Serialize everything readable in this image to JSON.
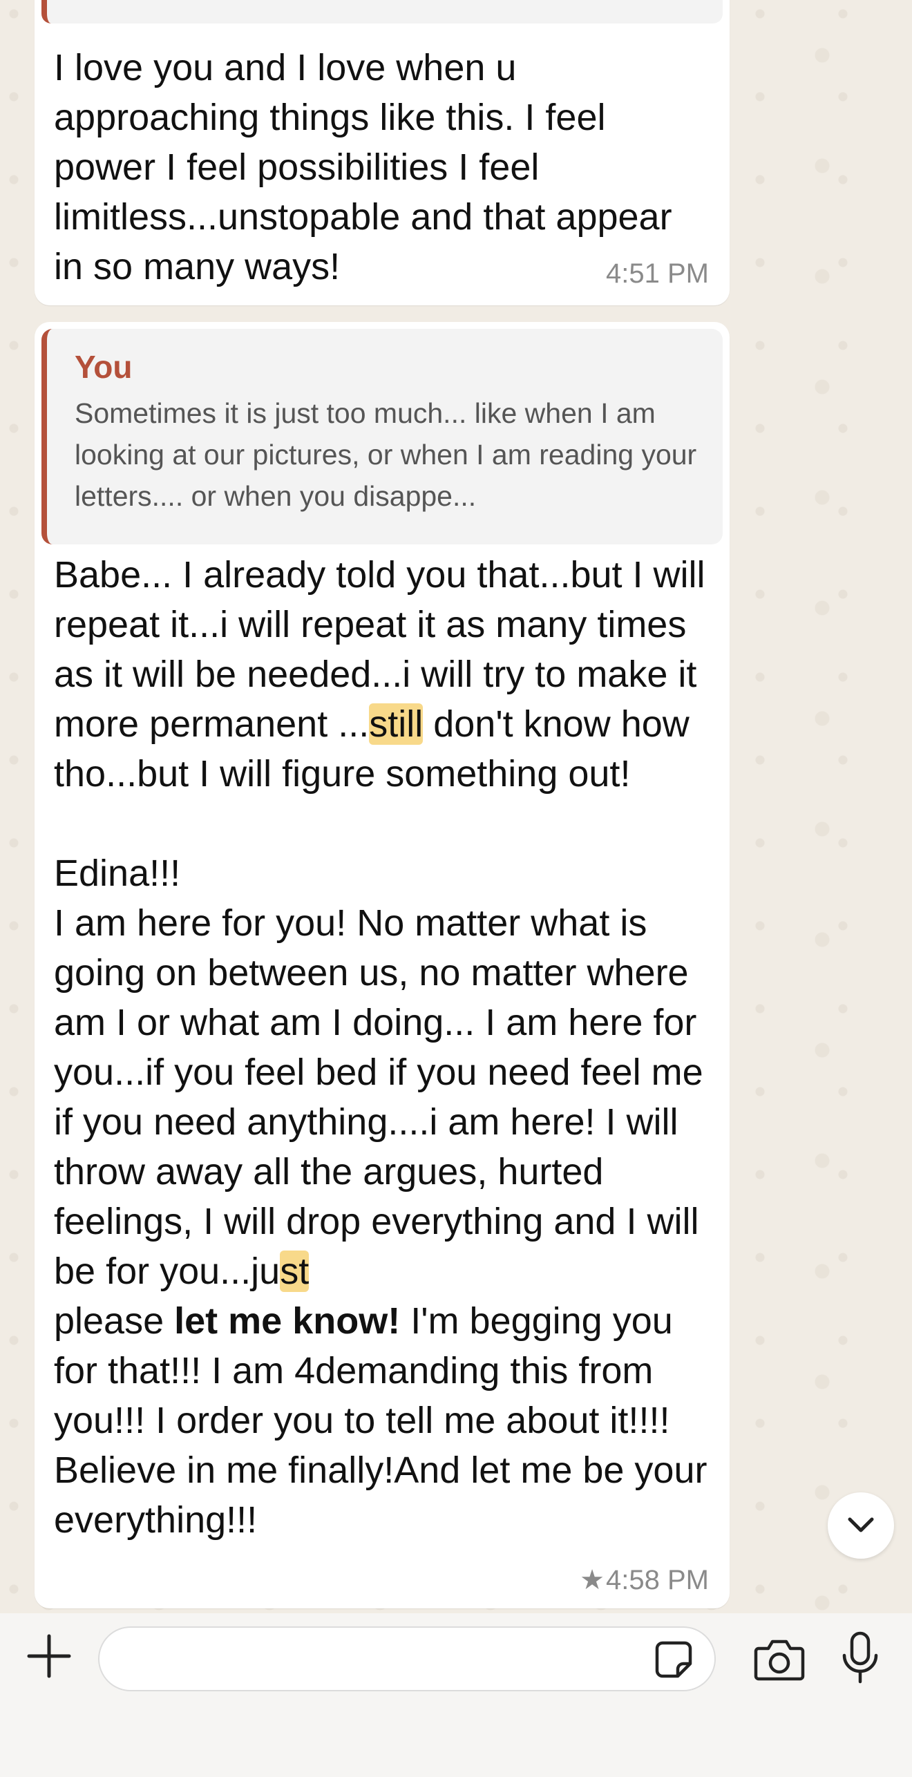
{
  "messages": [
    {
      "text": "I love you and I love when u approaching things like this. I feel power I feel possibilities I feel limitless...unstopable and that appear in so many ways!",
      "time": "4:51 PM"
    },
    {
      "quote_author": "You",
      "quote_text": "Sometimes it is just too much... like when I am looking at our pictures, or when I am reading your letters.... or when you disappe...",
      "text_parts": [
        "Babe... I already told you that...but I will repeat it...i will repeat it as many times as it will be needed...i will try to make it more permanent ...",
        "still",
        " don't know how tho...but I will figure something out!\n\nEdina!!!\nI am here for you! No matter what is going on between us, no matter where am I or what am I doing... I am here for you...if you feel bed if you need feel me if you need anything....i am here! I will throw away all the argues, hurted feelings, I will drop everything and I will be for you...ju",
        "st",
        "\nplease ",
        "let me know!",
        " I'm begging you for that!!! I am 4demanding this from you!!! I order you to tell me about it!!!! Believe in me finally!And let me be your everything!!!"
      ],
      "starred_icon": "star-icon",
      "time": "4:58 PM"
    }
  ],
  "colors": {
    "chat_background": "#f1ece4",
    "bubble": "#ffffff",
    "quote_accent": "#b4503a",
    "highlight": "#f8d98a",
    "timestamp": "#8a8a8a"
  },
  "icons": {
    "scroll_down": "chevron-down-icon",
    "attach": "plus-icon",
    "sticker": "sticker-icon",
    "camera": "camera-icon",
    "mic": "microphone-icon"
  }
}
